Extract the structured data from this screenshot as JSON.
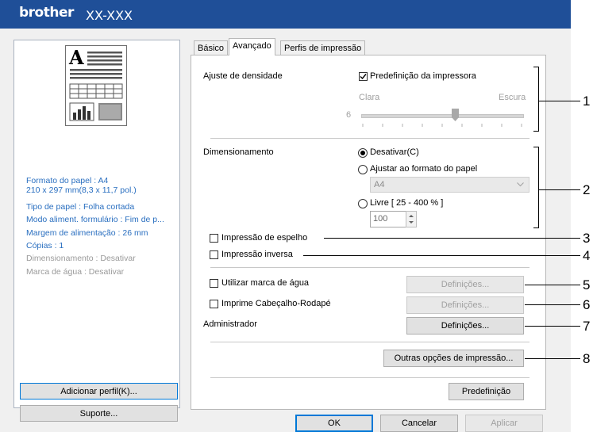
{
  "window": {
    "brand": "brother",
    "model": "XX-XXX"
  },
  "summary": [
    {
      "text": "Formato do papel : A4",
      "muted": false
    },
    {
      "text": "210 x 297 mm(8,3 x 11,7 pol.)",
      "muted": false
    },
    {
      "text": "Tipo de papel : Folha cortada",
      "muted": false
    },
    {
      "text": "Modo aliment. formulário : Fim de p...",
      "muted": false
    },
    {
      "text": "Margem de alimentação : 26 mm",
      "muted": false
    },
    {
      "text": "Cópias : 1",
      "muted": false
    },
    {
      "text": "Dimensionamento : Desativar",
      "muted": true
    },
    {
      "text": "Marca de água : Desativar",
      "muted": true
    }
  ],
  "buttons_left": {
    "add_profile": "Adicionar perfil(K)...",
    "support": "Suporte..."
  },
  "tabs": [
    "Básico",
    "Avançado",
    "Perfis de impressão"
  ],
  "density": {
    "label": "Ajuste de densidade",
    "printer_default_label": "Predefinição da impressora",
    "printer_default_checked": true,
    "light": "Clara",
    "dark": "Escura",
    "value": "6"
  },
  "scaling": {
    "label": "Dimensionamento",
    "off": "Desativar(C)",
    "fit": "Ajustar ao formato do papel",
    "paper": "A4",
    "free": "Livre [ 25 - 400 % ]",
    "percent": "100",
    "selected": "off"
  },
  "mirror": "Impressão de espelho",
  "reverse": "Impressão inversa",
  "watermark": {
    "label": "Utilizar marca de água",
    "btn": "Definições..."
  },
  "header_footer": {
    "label": "Imprime Cabeçalho-Rodapé",
    "btn": "Definições..."
  },
  "admin": {
    "label": "Administrador",
    "btn": "Definições..."
  },
  "other_options": "Outras opções de impressão...",
  "default_btn": "Predefinição",
  "footer": {
    "ok": "OK",
    "cancel": "Cancelar",
    "apply": "Aplicar"
  },
  "callouts": [
    "1",
    "2",
    "3",
    "4",
    "5",
    "6",
    "7",
    "8"
  ],
  "colors": {
    "titlebar": "#1f4f98",
    "summary_text": "#2a6fc0",
    "focus_border": "#0078d7"
  }
}
